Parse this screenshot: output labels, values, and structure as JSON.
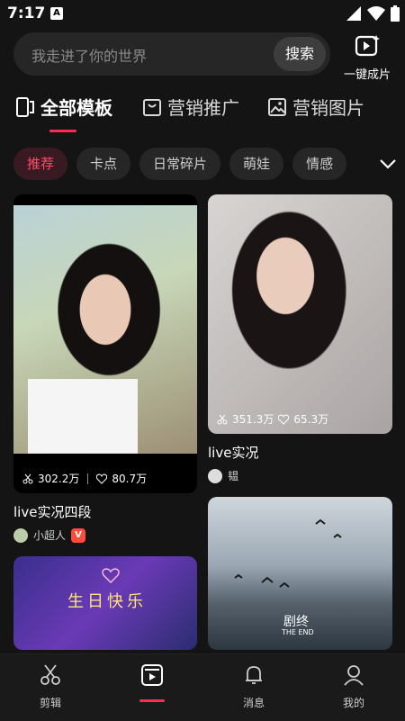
{
  "status": {
    "time": "7:17",
    "notif_icon": "A"
  },
  "search": {
    "placeholder": "我走进了你的世界",
    "button": "搜索"
  },
  "oneclick": {
    "label": "一键成片",
    "icon": "video-sparkle-icon"
  },
  "tabs": [
    {
      "label": "全部模板",
      "icon": "phone-template-icon"
    },
    {
      "label": "营销推广",
      "icon": "shopping-bag-icon"
    },
    {
      "label": "营销图片",
      "icon": "image-icon"
    }
  ],
  "chips": [
    "推荐",
    "卡点",
    "日常碎片",
    "萌娃",
    "情感"
  ],
  "cards": [
    {
      "title": "live实况四段",
      "author": "小超人",
      "uses": "302.2万",
      "likes": "80.7万",
      "verified_label": "V"
    },
    {
      "title": "live实况",
      "author": "韫",
      "uses": "351.3万",
      "likes": "65.3万"
    },
    {
      "title": "",
      "author": "",
      "uses": "",
      "likes": ""
    },
    {
      "title": "",
      "author": "",
      "uses": "",
      "likes": "",
      "overlay_text_1": "剧终",
      "overlay_text_2": "THE END"
    }
  ],
  "party_overlay": "生日快乐",
  "bottom_nav": [
    {
      "label": "剪辑",
      "icon": "scissors-icon"
    },
    {
      "label": "",
      "icon": "template-icon"
    },
    {
      "label": "消息",
      "icon": "bell-icon"
    },
    {
      "label": "我的",
      "icon": "user-icon"
    }
  ],
  "colors": {
    "accent": "#ff2d55",
    "background": "#141414"
  }
}
